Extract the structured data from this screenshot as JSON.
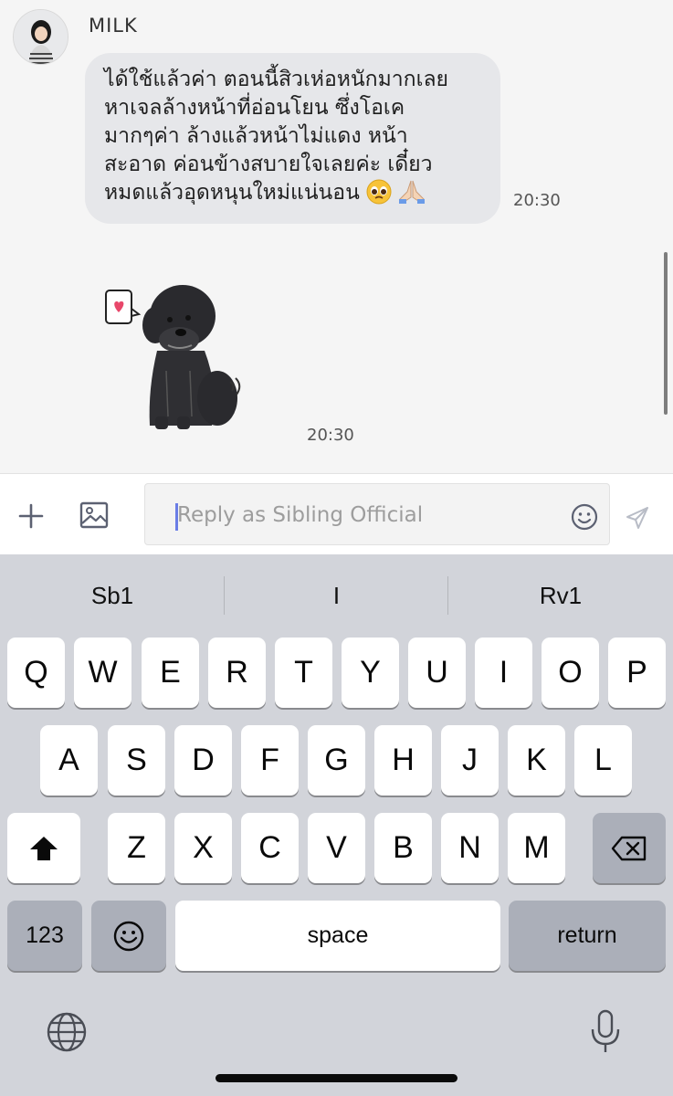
{
  "chat": {
    "sender_name": "MILK",
    "message": {
      "lines": [
        "ได้ใช้แล้วค่า ตอนนี้สิวเห่อหนักมากเลย",
        "หาเจลล้างหน้าที่อ่อนโยน ซึ่งโอเค",
        "มากๆค่า ล้างแล้วหน้าไม่แดง หน้า",
        "สะอาด ค่อนข้างสบายใจเลยค่ะ เดี๋ยว",
        "หมดแล้วอุดหนุนใหม่แน่นอน"
      ],
      "emojis": [
        "pleading-face",
        "folded-hands"
      ],
      "time": "20:30"
    },
    "sticker": {
      "description_icon": "dog-with-heart-sticker",
      "time": "20:30"
    }
  },
  "composer": {
    "placeholder": "Reply as Sibling Official",
    "icons": [
      "plus-icon",
      "image-icon",
      "smiley-icon",
      "send-icon"
    ]
  },
  "keyboard": {
    "suggestions": [
      "Sb1",
      "I",
      "Rv1"
    ],
    "row1": [
      "Q",
      "W",
      "E",
      "R",
      "T",
      "Y",
      "U",
      "I",
      "O",
      "P"
    ],
    "row2": [
      "A",
      "S",
      "D",
      "F",
      "G",
      "H",
      "J",
      "K",
      "L"
    ],
    "row3": [
      "Z",
      "X",
      "C",
      "V",
      "B",
      "N",
      "M"
    ],
    "numbers_label": "123",
    "space_label": "space",
    "return_label": "return"
  },
  "colors": {
    "bubble": "#e6e7ea",
    "chat_background": "#f5f5f5",
    "keyboard_background": "#d2d4da",
    "caret": "#6a7de6"
  }
}
